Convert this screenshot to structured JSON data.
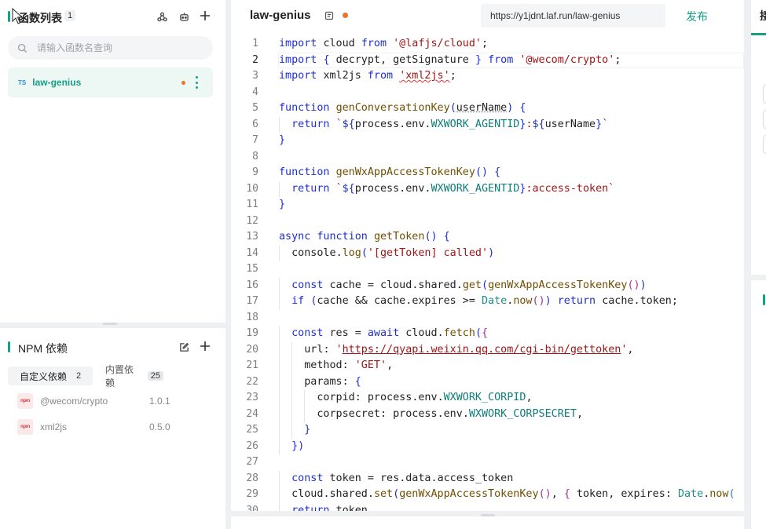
{
  "functions_panel": {
    "title": "函数列表",
    "count": "1",
    "search_placeholder": "请输入函数名查询",
    "items": [
      {
        "lang": "TS",
        "name": "law-genius",
        "unsaved": true
      }
    ]
  },
  "npm_panel": {
    "title": "NPM 依赖",
    "tabs": [
      {
        "label": "自定义依赖",
        "count": "2",
        "active": true
      },
      {
        "label": "内置依赖",
        "count": "25",
        "active": false
      }
    ],
    "dependencies": [
      {
        "icon_text": "npm",
        "name": "@wecom/crypto",
        "version": "1.0.1"
      },
      {
        "icon_text": "npm",
        "name": "xml2js",
        "version": "0.5.0"
      }
    ]
  },
  "editor": {
    "title": "law-genius",
    "url": "https://y1jdnt.laf.run/law-genius",
    "publish_label": "发布",
    "current_line": 2,
    "lines": [
      {
        "n": "1",
        "code": "import cloud from '@lafjs/cloud';"
      },
      {
        "n": "2",
        "code": "import { decrypt, getSignature } from '@wecom/crypto';"
      },
      {
        "n": "3",
        "code": "import xml2js from 'xml2js';"
      },
      {
        "n": "4",
        "code": ""
      },
      {
        "n": "5",
        "code": "function genConversationKey(userName) {"
      },
      {
        "n": "6",
        "code": "  return `${process.env.WXWORK_AGENTID}:${userName}`"
      },
      {
        "n": "7",
        "code": "}"
      },
      {
        "n": "8",
        "code": ""
      },
      {
        "n": "9",
        "code": "function genWxAppAccessTokenKey() {"
      },
      {
        "n": "10",
        "code": "  return `${process.env.WXWORK_AGENTID}:access-token`"
      },
      {
        "n": "11",
        "code": "}"
      },
      {
        "n": "12",
        "code": ""
      },
      {
        "n": "13",
        "code": "async function getToken() {"
      },
      {
        "n": "14",
        "code": "  console.log('[getToken] called')"
      },
      {
        "n": "15",
        "code": ""
      },
      {
        "n": "16",
        "code": "  const cache = cloud.shared.get(genWxAppAccessTokenKey())"
      },
      {
        "n": "17",
        "code": "  if (cache && cache.expires >= Date.now()) return cache.token;"
      },
      {
        "n": "18",
        "code": ""
      },
      {
        "n": "19",
        "code": "  const res = await cloud.fetch({"
      },
      {
        "n": "20",
        "code": "    url: 'https://qyapi.weixin.qq.com/cgi-bin/gettoken',"
      },
      {
        "n": "21",
        "code": "    method: 'GET',"
      },
      {
        "n": "22",
        "code": "    params: {"
      },
      {
        "n": "23",
        "code": "      corpid: process.env.WXWORK_CORPID,"
      },
      {
        "n": "24",
        "code": "      corpsecret: process.env.WXWORK_CORPSECRET,"
      },
      {
        "n": "25",
        "code": "    }"
      },
      {
        "n": "26",
        "code": "  })"
      },
      {
        "n": "27",
        "code": ""
      },
      {
        "n": "28",
        "code": "  const token = res.data.access_token"
      },
      {
        "n": "29",
        "code": "  cloud.shared.set(genWxAppAccessTokenKey(), { token, expires: Date.now("
      },
      {
        "n": "30",
        "code": "  return token"
      }
    ]
  },
  "right_panel": {
    "tab_char": "接"
  },
  "colors": {
    "accent": "#16a085",
    "unsaved_dot": "#e8762b",
    "keyword": "#1f2fd1",
    "string": "#a31515",
    "property": "#0f7c7a"
  }
}
